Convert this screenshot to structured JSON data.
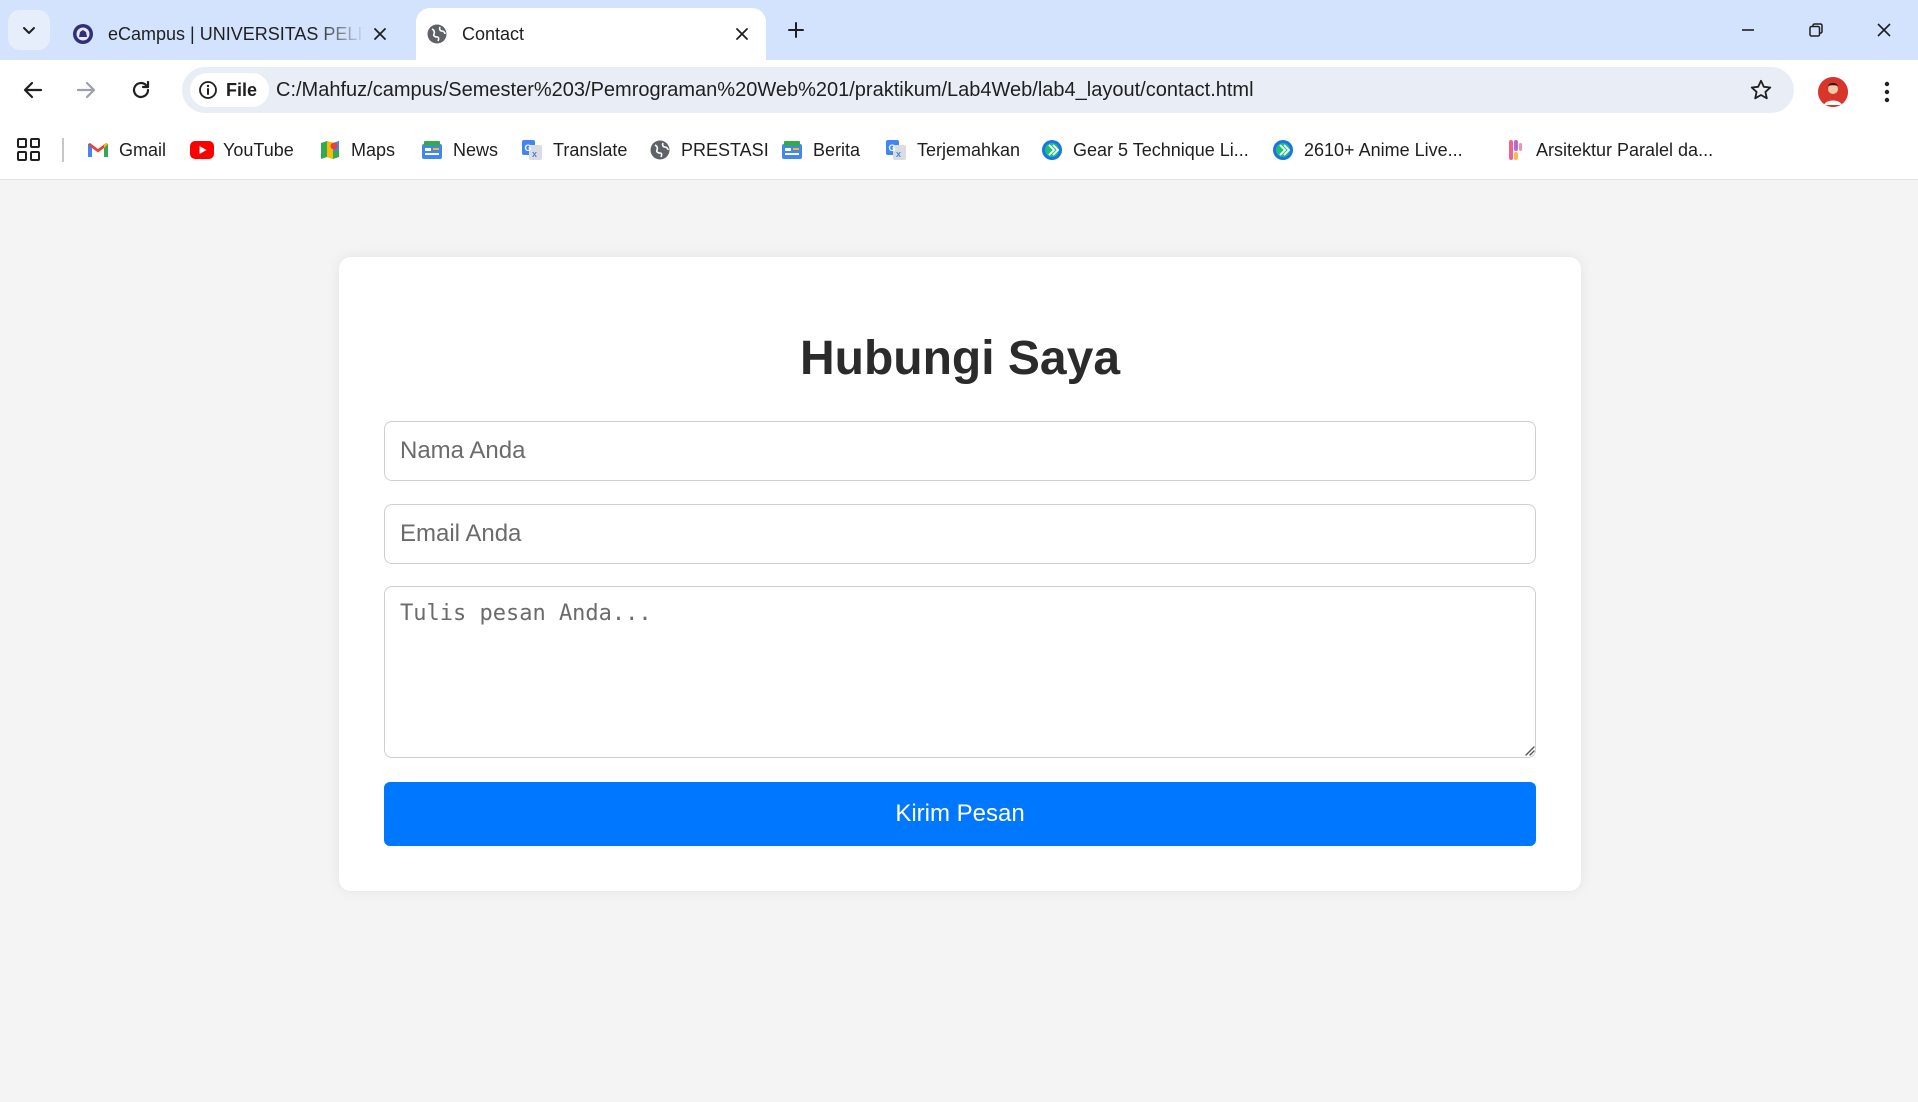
{
  "browser": {
    "tabs": [
      {
        "title": "eCampus | UNIVERSITAS PELITA",
        "icon": "university-seal-icon",
        "active": false
      },
      {
        "title": "Contact",
        "icon": "globe-icon",
        "active": true
      }
    ],
    "address": {
      "scheme_chip": "File",
      "url": "C:/Mahfuz/campus/Semester%203/Pemrograman%20Web%201/praktikum/Lab4Web/lab4_layout/contact.html"
    },
    "bookmarks": [
      {
        "label": "Gmail",
        "icon": "gmail-icon"
      },
      {
        "label": "YouTube",
        "icon": "youtube-icon"
      },
      {
        "label": "Maps",
        "icon": "maps-icon"
      },
      {
        "label": "News",
        "icon": "news-icon"
      },
      {
        "label": "Translate",
        "icon": "translate-icon"
      },
      {
        "label": "PRESTASI",
        "icon": "globe-icon"
      },
      {
        "label": "Berita",
        "icon": "news-icon"
      },
      {
        "label": "Terjemahkan",
        "icon": "translate-icon"
      },
      {
        "label": "Gear 5 Technique Li...",
        "icon": "chevron-circle-icon"
      },
      {
        "label": "2610+ Anime Live...",
        "icon": "chevron-circle-icon"
      },
      {
        "label": "Arsitektur Paralel da...",
        "icon": "gradient-bookmark-icon"
      }
    ]
  },
  "contact_form": {
    "title": "Hubungi Saya",
    "name_placeholder": "Nama Anda",
    "email_placeholder": "Email Anda",
    "message_placeholder": "Tulis pesan Anda...",
    "submit_label": "Kirim Pesan"
  },
  "colors": {
    "accent": "#0077ff",
    "page_background": "#f4f4f4",
    "tabstrip": "#d3e3fd"
  }
}
